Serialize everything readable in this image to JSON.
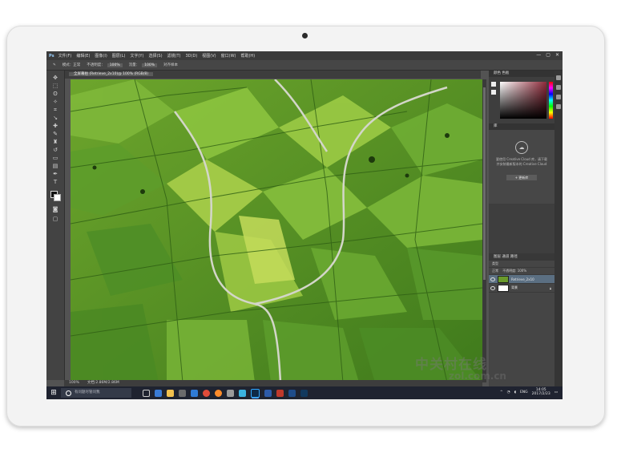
{
  "app": {
    "logo": "Ps",
    "menu": [
      "文件(F)",
      "编辑(E)",
      "图像(I)",
      "图层(L)",
      "文字(Y)",
      "选择(S)",
      "滤镜(T)",
      "3D(D)",
      "视图(V)",
      "窗口(W)",
      "帮助(H)"
    ],
    "window_controls": [
      "—",
      "▢",
      "✕"
    ]
  },
  "options_bar": {
    "mode_label": "模式：正常",
    "opacity_label": "不透明度：",
    "opacity_value": "100%",
    "flow_label": "流量：",
    "flow_value": "100%",
    "align_label": "对齐样本"
  },
  "document": {
    "tab_title": "全屏幕拍 (Retrieve_2x10)@ 100% (RGB/8)",
    "zoom": "100%",
    "doc_info": "文档:2.86M/2.86M"
  },
  "panels": {
    "color_tab": "颜色  色板",
    "libraries_title": "库",
    "libraries_hint": "要使用 Creative Cloud 库，请下载并安装最新版本的 Creative Cloud",
    "libraries_button": "+ 更新库",
    "layers_tabs": "图层  通道  路径",
    "layers_filter": "类型",
    "layers_blend": "正常",
    "layers_opacity": "不透明度: 100%",
    "layers": [
      {
        "name": "Retrieve_2x10",
        "selected": true,
        "thumb": "image"
      },
      {
        "name": "背景",
        "selected": false,
        "thumb": "white"
      }
    ]
  },
  "taskbar": {
    "search_placeholder": "有问题尽管问我",
    "time": "14:05",
    "date": "2017/2/23",
    "lang": "ENG",
    "pinned_icons": [
      "task-view-icon",
      "edge-icon",
      "file-explorer-icon",
      "store-icon",
      "mail-icon",
      "chrome-icon",
      "firefox-icon",
      "app-icon",
      "photos-icon",
      "photoshop-icon",
      "app2-icon",
      "app3-icon",
      "app4-icon",
      "app5-icon"
    ]
  },
  "watermark": {
    "line1": "中关村在线",
    "line2": "zol.com.cn"
  },
  "colors": {
    "field_green": "#5a8a24",
    "ps_dark": "#535353",
    "taskbar": "#1f2330",
    "selected_layer": "#5b6f82"
  }
}
